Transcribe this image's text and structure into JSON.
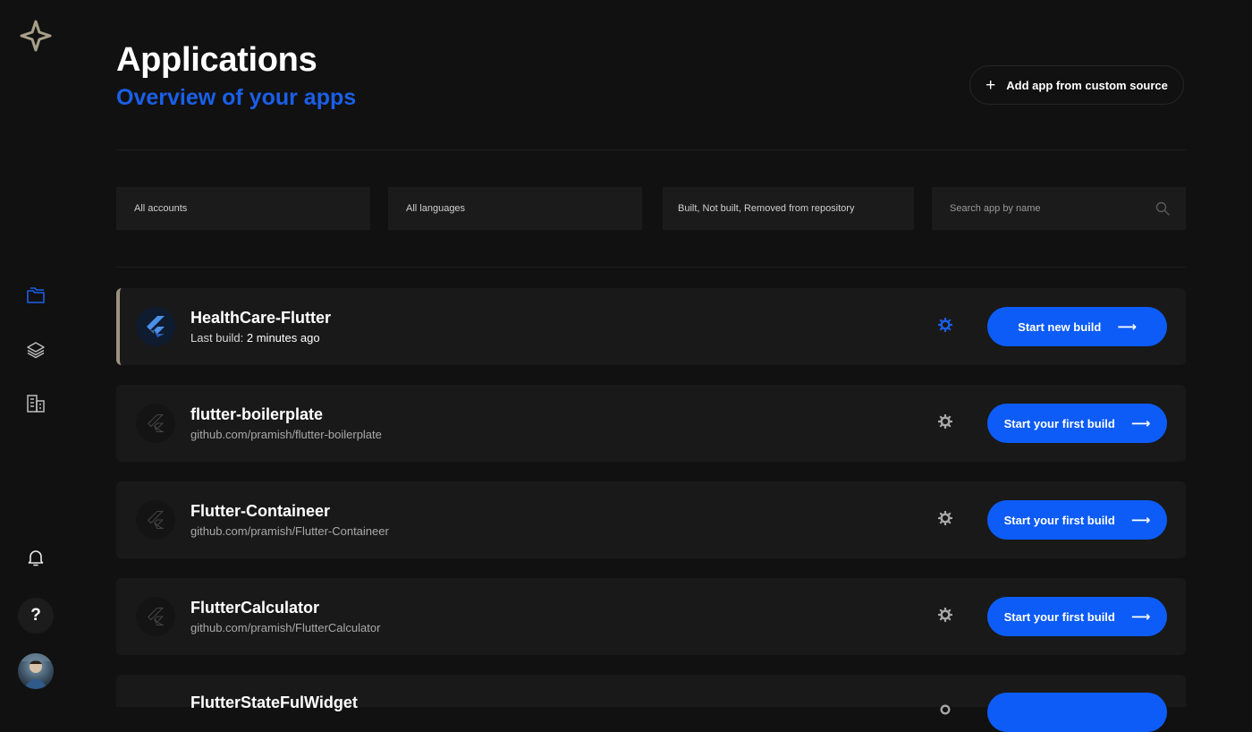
{
  "header": {
    "title": "Applications",
    "subtitle": "Overview of your apps",
    "add_button_label": "Add app from custom source",
    "add_button_icon": "+"
  },
  "filters": {
    "accounts": "All accounts",
    "languages": "All languages",
    "build_status": "Built, Not built, Removed from repository",
    "search_placeholder": "Search app by name"
  },
  "apps": [
    {
      "name": "HealthCare-Flutter",
      "subtitle_label": "Last build:",
      "subtitle_value": "2 minutes ago",
      "button_label": "Start new build",
      "active": true
    },
    {
      "name": "flutter-boilerplate",
      "subtitle": "github.com/pramish/flutter-boilerplate",
      "button_label": "Start your first build"
    },
    {
      "name": "Flutter-Containeer",
      "subtitle": "github.com/pramish/Flutter-Containeer",
      "button_label": "Start your first build"
    },
    {
      "name": "FlutterCalculator",
      "subtitle": "github.com/pramish/FlutterCalculator",
      "button_label": "Start your first build"
    },
    {
      "name": "FlutterStateFulWidget",
      "subtitle": "",
      "button_label": ""
    }
  ],
  "sidebar": {
    "help_label": "?",
    "icons": [
      "logo-icon",
      "folders-icon",
      "layers-icon",
      "buildings-icon",
      "bell-icon",
      "help-icon",
      "avatar"
    ]
  },
  "colors": {
    "background": "#111111",
    "card": "#191919",
    "accent": "#0d5cf7",
    "subtitle": "#1a5fe8"
  }
}
